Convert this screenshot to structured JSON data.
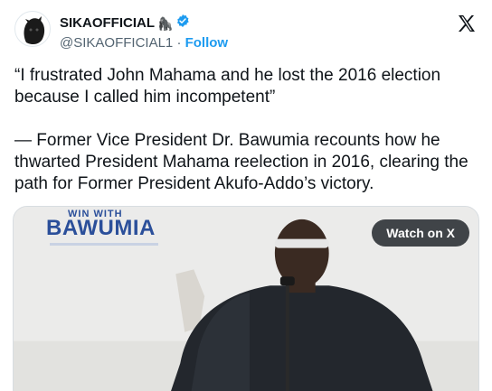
{
  "author": {
    "display_name": "SIKAOFFICIAL",
    "name_emoji": "🦍",
    "handle": "@SIKAOFFICIAL1",
    "separator": "·",
    "follow_label": "Follow",
    "verified_color": "#1d9bf0"
  },
  "tweet": {
    "quote": "“I frustrated John Mahama and he lost  the 2016 election because I called him incompetent”",
    "body": "— Former Vice President Dr. Bawumia recounts how he thwarted President Mahama reelection in 2016, clearing the path for Former President Akufo-Addo’s victory."
  },
  "media": {
    "logo_top": "WIN WITH",
    "logo_name": "BAWUMIA",
    "watch_label": "Watch on X"
  },
  "icons": {
    "brand": "x-logo-icon",
    "verified": "verified-badge-icon"
  },
  "colors": {
    "accent": "#1d9bf0",
    "text": "#0f1419",
    "secondary": "#536471"
  }
}
